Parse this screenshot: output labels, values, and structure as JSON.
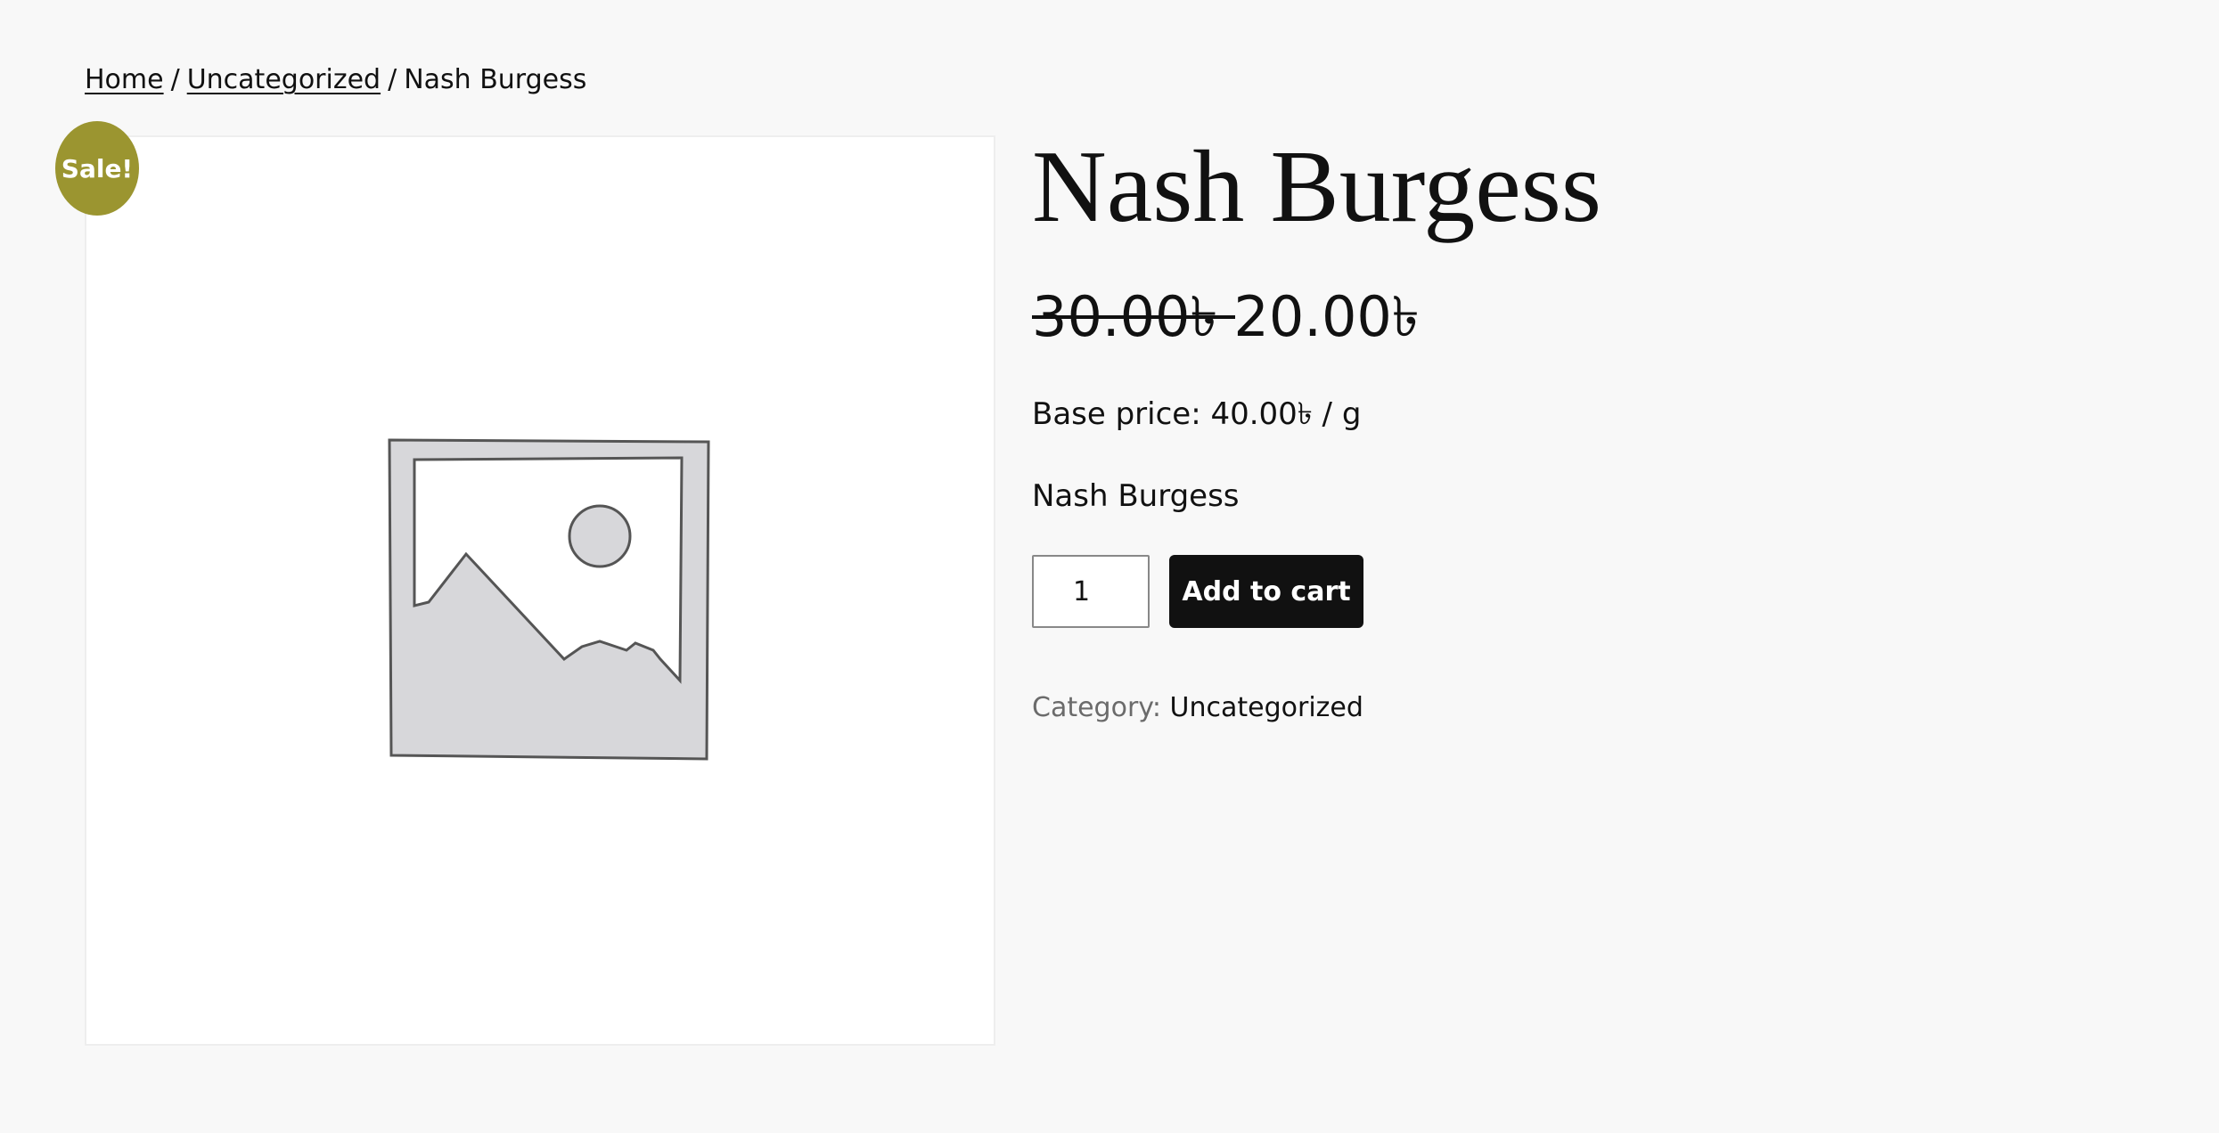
{
  "breadcrumb": {
    "items": [
      {
        "label": "Home"
      },
      {
        "label": "Uncategorized"
      }
    ],
    "separator": "/",
    "current": "Nash Burgess"
  },
  "gallery": {
    "sale_badge": "Sale!",
    "placeholder_icon": "image-placeholder-icon"
  },
  "product": {
    "title": "Nash Burgess",
    "price_regular": "30.00৳",
    "price_sale": "20.00৳",
    "base_price": "Base price: 40.00৳  / g",
    "description": "Nash Burgess",
    "quantity": "1",
    "add_to_cart_label": "Add to cart",
    "category_label": "Category:",
    "category_value": "Uncategorized"
  },
  "colors": {
    "sale_badge": "#9b9530",
    "button": "#111111",
    "background": "#f8f8f8"
  }
}
